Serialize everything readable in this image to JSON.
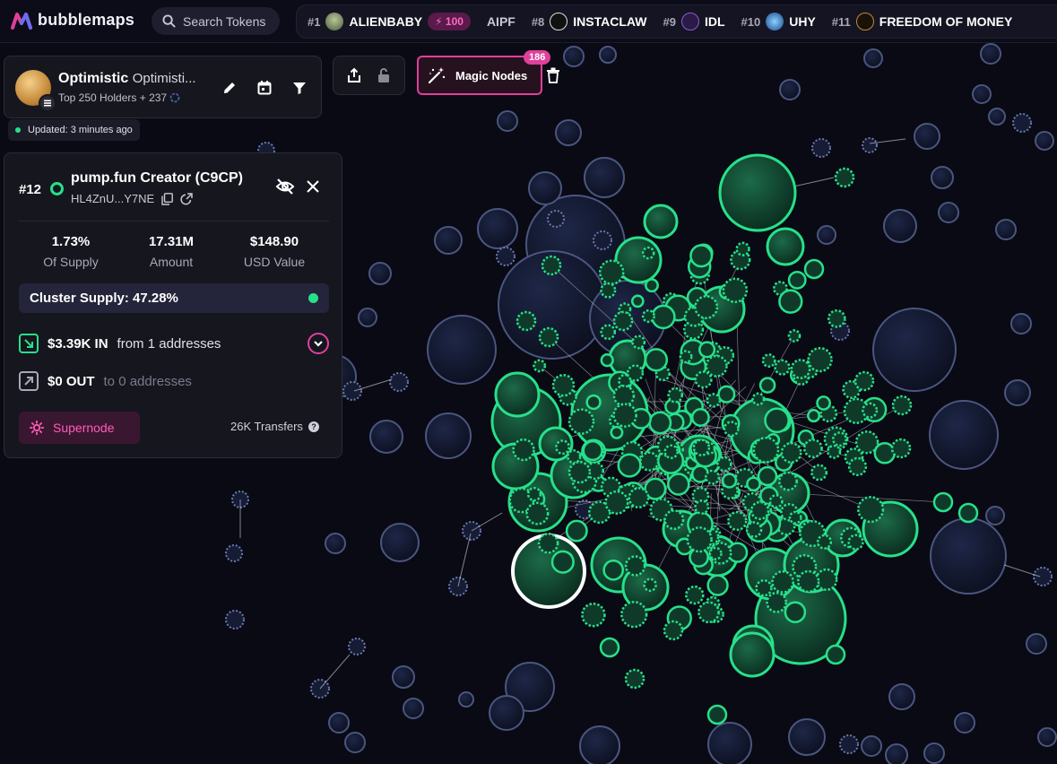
{
  "app": {
    "name": "bubblemaps"
  },
  "search": {
    "placeholder": "Search Tokens"
  },
  "ticker": [
    {
      "rank": "#1",
      "name": "ALIENBABY",
      "boost": "100"
    },
    {
      "rank": "",
      "name": "AIPF"
    },
    {
      "rank": "#8",
      "name": "INSTACLAW"
    },
    {
      "rank": "#9",
      "name": "IDL"
    },
    {
      "rank": "#10",
      "name": "UHY"
    },
    {
      "rank": "#11",
      "name": "FREEDOM OF MONEY"
    }
  ],
  "token": {
    "name": "Optimistic",
    "symbol": "Optimisti...",
    "holders": "Top 250 Holders + 237",
    "updated": "Updated: 3 minutes ago"
  },
  "magic_nodes": {
    "label": "Magic Nodes",
    "count": "186"
  },
  "holder": {
    "rank": "#12",
    "name": "pump.fun Creator (C9CP)",
    "address": "HL4ZnU...Y7NE",
    "stats": [
      {
        "value": "1.73%",
        "label": "Of Supply"
      },
      {
        "value": "17.31M",
        "label": "Amount"
      },
      {
        "value": "$148.90",
        "label": "USD Value"
      }
    ],
    "cluster_supply": "Cluster Supply: 47.28%",
    "in_amount": "$3.39K IN",
    "in_from": "from 1 addresses",
    "out_amount": "$0 OUT",
    "out_to": "to 0 addresses",
    "supernode": "Supernode",
    "transfers": "26K Transfers"
  },
  "colors": {
    "accent": "#e0409a",
    "green": "#27e08a",
    "bubble_blue": "#1c2340",
    "bg": "#0a0a14"
  }
}
